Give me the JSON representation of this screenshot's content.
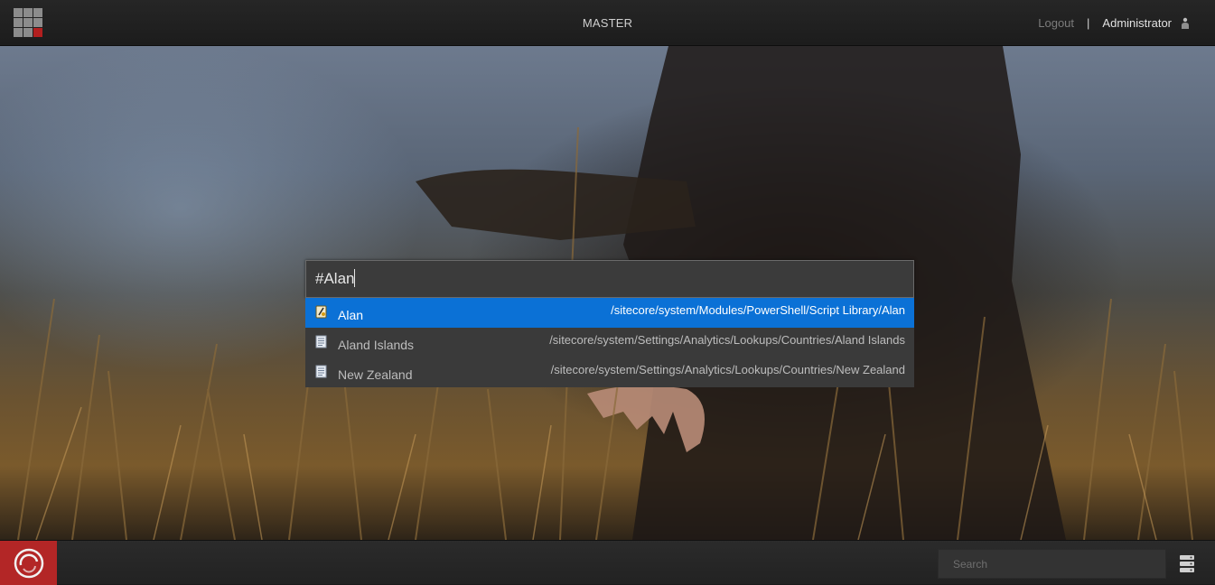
{
  "header": {
    "database": "MASTER",
    "logout_label": "Logout",
    "separator": "|",
    "user_name": "Administrator"
  },
  "search": {
    "query": "#Alan"
  },
  "suggestions": [
    {
      "name": "Alan",
      "path": "/sitecore/system/Modules/PowerShell/Script Library/Alan",
      "icon": "script-icon",
      "selected": true
    },
    {
      "name": "Aland Islands",
      "path": "/sitecore/system/Settings/Analytics/Lookups/Countries/Aland Islands",
      "icon": "document-icon",
      "selected": false
    },
    {
      "name": "New Zealand",
      "path": "/sitecore/system/Settings/Analytics/Lookups/Countries/New Zealand",
      "icon": "document-icon",
      "selected": false
    }
  ],
  "footer": {
    "search_placeholder": "Search"
  },
  "colors": {
    "selected_row": "#0b71d6",
    "brand_red": "#b32626"
  }
}
